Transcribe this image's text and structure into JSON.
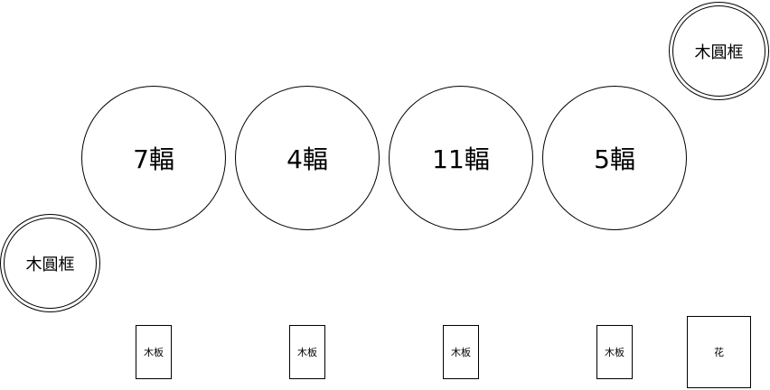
{
  "diagram": {
    "circles": [
      {
        "label": "7輻"
      },
      {
        "label": "4輻"
      },
      {
        "label": "11輻"
      },
      {
        "label": "5輻"
      }
    ],
    "frames": [
      {
        "label": "木圓框"
      },
      {
        "label": "木圓框"
      }
    ],
    "boards": [
      {
        "label": "木板"
      },
      {
        "label": "木板"
      },
      {
        "label": "木板"
      },
      {
        "label": "木板"
      }
    ],
    "flower": {
      "label": "花"
    }
  },
  "colors": {
    "stroke": "#000000",
    "fill": "#ffffff"
  }
}
